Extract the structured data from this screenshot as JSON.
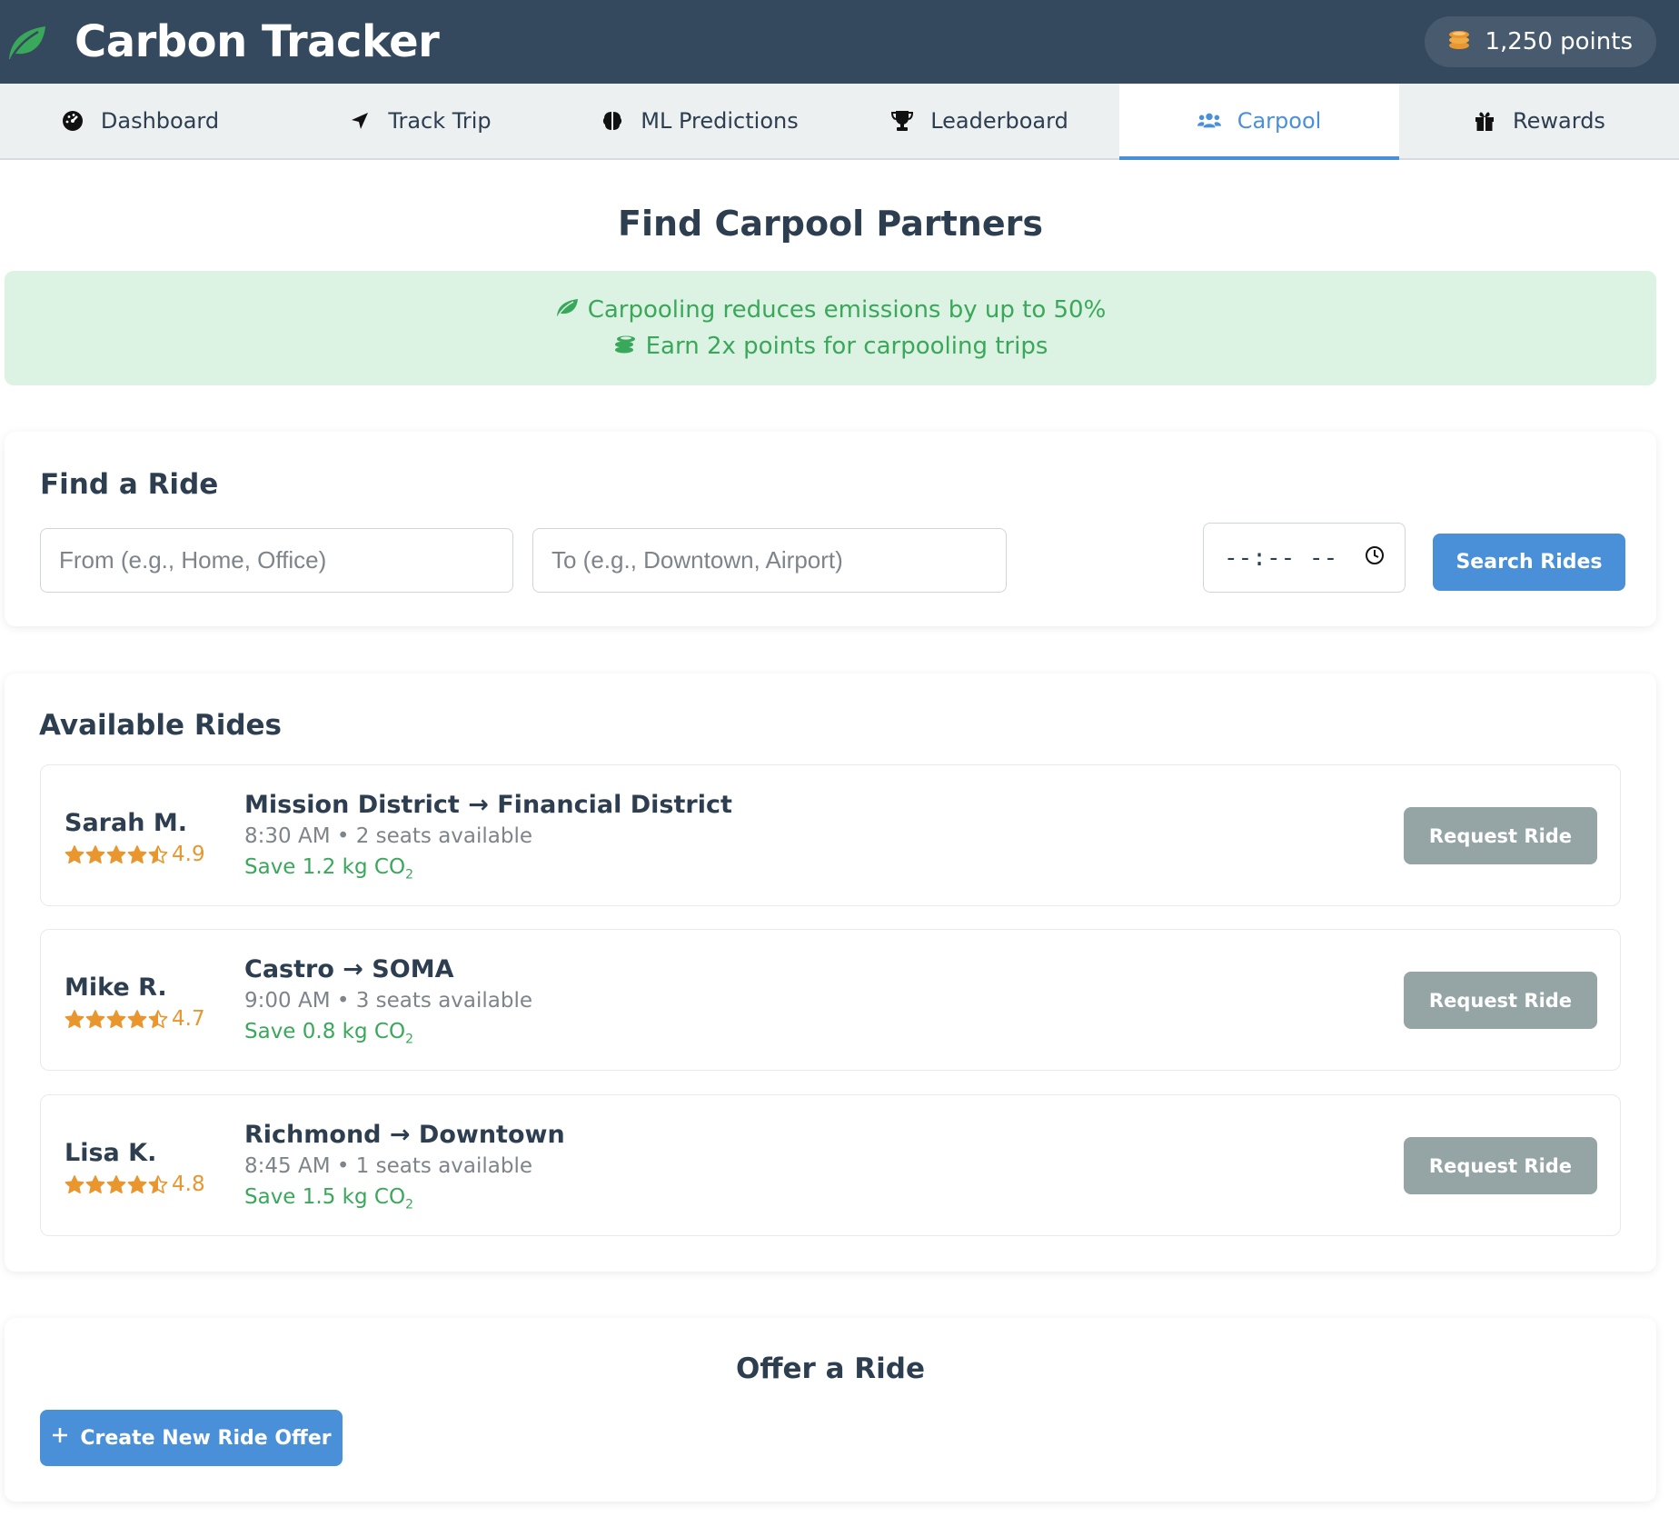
{
  "app": {
    "title": "Carbon Tracker",
    "points": "1,250 points"
  },
  "nav": {
    "items": [
      {
        "label": "Dashboard",
        "icon": "gauge-icon"
      },
      {
        "label": "Track Trip",
        "icon": "location-arrow-icon"
      },
      {
        "label": "ML Predictions",
        "icon": "brain-icon"
      },
      {
        "label": "Leaderboard",
        "icon": "trophy-icon"
      },
      {
        "label": "Carpool",
        "icon": "users-icon",
        "active": true
      },
      {
        "label": "Rewards",
        "icon": "gift-icon"
      }
    ]
  },
  "page": {
    "title": "Find Carpool Partners"
  },
  "info": {
    "line1": "Carpooling reduces emissions by up to 50%",
    "line2": "Earn 2x points for carpooling trips"
  },
  "find": {
    "title": "Find a Ride",
    "from_placeholder": "From (e.g., Home, Office)",
    "to_placeholder": "To (e.g., Downtown, Airport)",
    "time_value": "--:-- --",
    "search_label": "Search Rides"
  },
  "rides": {
    "title": "Available Rides",
    "request_label": "Request Ride",
    "items": [
      {
        "driver": "Sarah M.",
        "rating": "4.9",
        "stars": 4.5,
        "route": "Mission District → Financial District",
        "meta": "8:30 AM • 2 seats available",
        "save": "Save 1.2 kg CO",
        "save_sub": "2"
      },
      {
        "driver": "Mike R.",
        "rating": "4.7",
        "stars": 4.5,
        "route": "Castro → SOMA",
        "meta": "9:00 AM • 3 seats available",
        "save": "Save 0.8 kg CO",
        "save_sub": "2"
      },
      {
        "driver": "Lisa K.",
        "rating": "4.8",
        "stars": 4.5,
        "route": "Richmond → Downtown",
        "meta": "8:45 AM • 1 seats available",
        "save": "Save 1.5 kg CO",
        "save_sub": "2"
      }
    ]
  },
  "offer": {
    "title": "Offer a Ride",
    "create_label": "Create New Ride Offer"
  },
  "colors": {
    "header": "#34495e",
    "accent": "#4a90d9",
    "green": "#3aa85a",
    "star": "#e9962e",
    "muted_button": "#95a5a6"
  }
}
